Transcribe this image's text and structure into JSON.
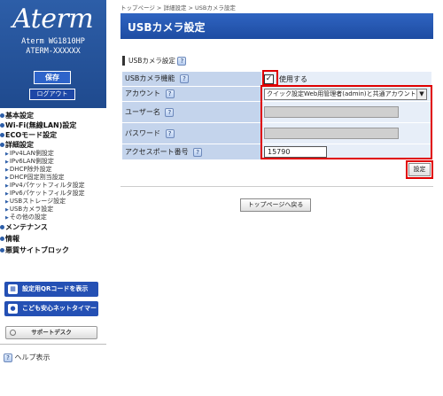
{
  "sidebar": {
    "logo": "Aterm",
    "model_line1": "Aterm WG1810HP",
    "model_line2": "ATERM-XXXXXX",
    "save_label": "保存",
    "logout_label": "ログアウト",
    "nav": [
      {
        "type": "main",
        "label": "基本設定"
      },
      {
        "type": "main",
        "label": "Wi-Fi(無線LAN)設定"
      },
      {
        "type": "main",
        "label": "ECOモード設定"
      },
      {
        "type": "main",
        "label": "詳細設定"
      },
      {
        "type": "sub",
        "label": "IPv4LAN側設定"
      },
      {
        "type": "sub",
        "label": "IPv6LAN側設定"
      },
      {
        "type": "sub",
        "label": "DHCP除外設定"
      },
      {
        "type": "sub",
        "label": "DHCP固定割当設定"
      },
      {
        "type": "sub",
        "label": "IPv4パケットフィルタ設定"
      },
      {
        "type": "sub",
        "label": "IPv6パケットフィルタ設定"
      },
      {
        "type": "sub",
        "label": "USBストレージ設定"
      },
      {
        "type": "sub",
        "label": "USBカメラ設定"
      },
      {
        "type": "sub",
        "label": "その他の設定"
      },
      {
        "type": "main",
        "label": "メンテナンス"
      },
      {
        "type": "main",
        "label": "情報"
      },
      {
        "type": "main",
        "label": "悪質サイトブロック"
      }
    ],
    "qr_button": "設定用QRコードを表示",
    "timer_button": "こども安心ネットタイマー",
    "support_button": "サポートデスク",
    "help_label": "ヘルプ表示",
    "help_icon": "?"
  },
  "breadcrumb": "トップページ > 詳細設定 > USBカメラ設定",
  "page_title": "USBカメラ設定",
  "section_title": "USBカメラ設定",
  "help_icon_glyph": "?",
  "form": {
    "camera_label": "USBカメラ機能",
    "camera_checked": "✓",
    "camera_option": "使用する",
    "account_label": "アカウント",
    "account_value": "クイック設定Web用管理者(admin)と共通アカウント",
    "username_label": "ユーザー名",
    "username_value": "",
    "password_label": "パスワード",
    "password_value": "",
    "port_label": "アクセスポート番号",
    "port_value": "15790"
  },
  "set_button": "設定",
  "back_button": "トップページへ戻る",
  "colors": {
    "header_blue": "#1e4ca2",
    "highlight_red": "#e00000",
    "label_bg": "#c4d4ec"
  }
}
